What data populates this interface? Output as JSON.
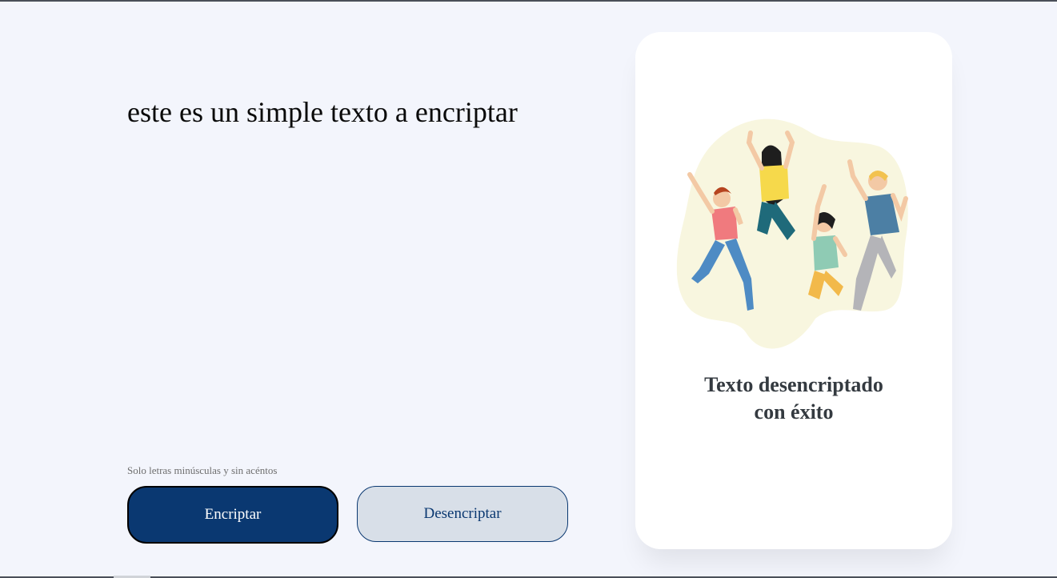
{
  "main": {
    "input_text": "este es un simple texto a encriptar",
    "hint": "Solo letras minúsculas y sin acéntos",
    "encrypt_label": "Encriptar",
    "decrypt_label": "Desencriptar"
  },
  "card": {
    "message_line1": "Texto desencriptado",
    "message_line2": "con éxito",
    "illustration": "jumping-people-illustration"
  },
  "colors": {
    "background": "#F3F5FC",
    "primary": "#0A3871",
    "secondary": "#D8DFE8",
    "card": "#FFFFFF",
    "text": "#0A0A0A",
    "card_text": "#343A40"
  }
}
